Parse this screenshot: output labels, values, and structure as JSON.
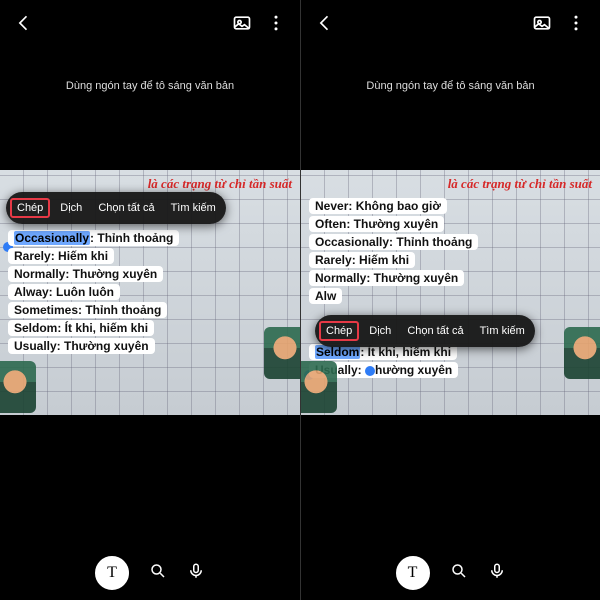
{
  "hint": "Dùng ngón tay để tô sáng văn bản",
  "heading": "là các trạng từ chỉ tần suất",
  "context_menu": {
    "copy": "Chép",
    "translate": "Dịch",
    "select_all": "Chọn tất cả",
    "search": "Tìm kiếm"
  },
  "left": {
    "selection_word": "Occasionally",
    "selection_rest": ": Thỉnh thoảng",
    "lines": [
      "Rarely: Hiếm khi",
      "Normally: Thường xuyên",
      "Alway: Luôn luôn",
      "Sometimes: Thỉnh thoảng",
      "Seldom: Ít khi, hiếm khi",
      "Usually: Thường xuyên"
    ]
  },
  "right": {
    "pre_lines": [
      "Never: Không bao giờ",
      "Often: Thường xuyên",
      "Occasionally: Thỉnh thoảng",
      "Rarely: Hiếm khi",
      "Normally: Thường xuyên",
      "Alw"
    ],
    "selection_word": "Seldom",
    "selection_rest": ": Ít khi, hiếm khi",
    "post_line_pre": "Usually: ",
    "post_line_post": "hường xuyên"
  },
  "bottom": {
    "text_mode": "T"
  }
}
